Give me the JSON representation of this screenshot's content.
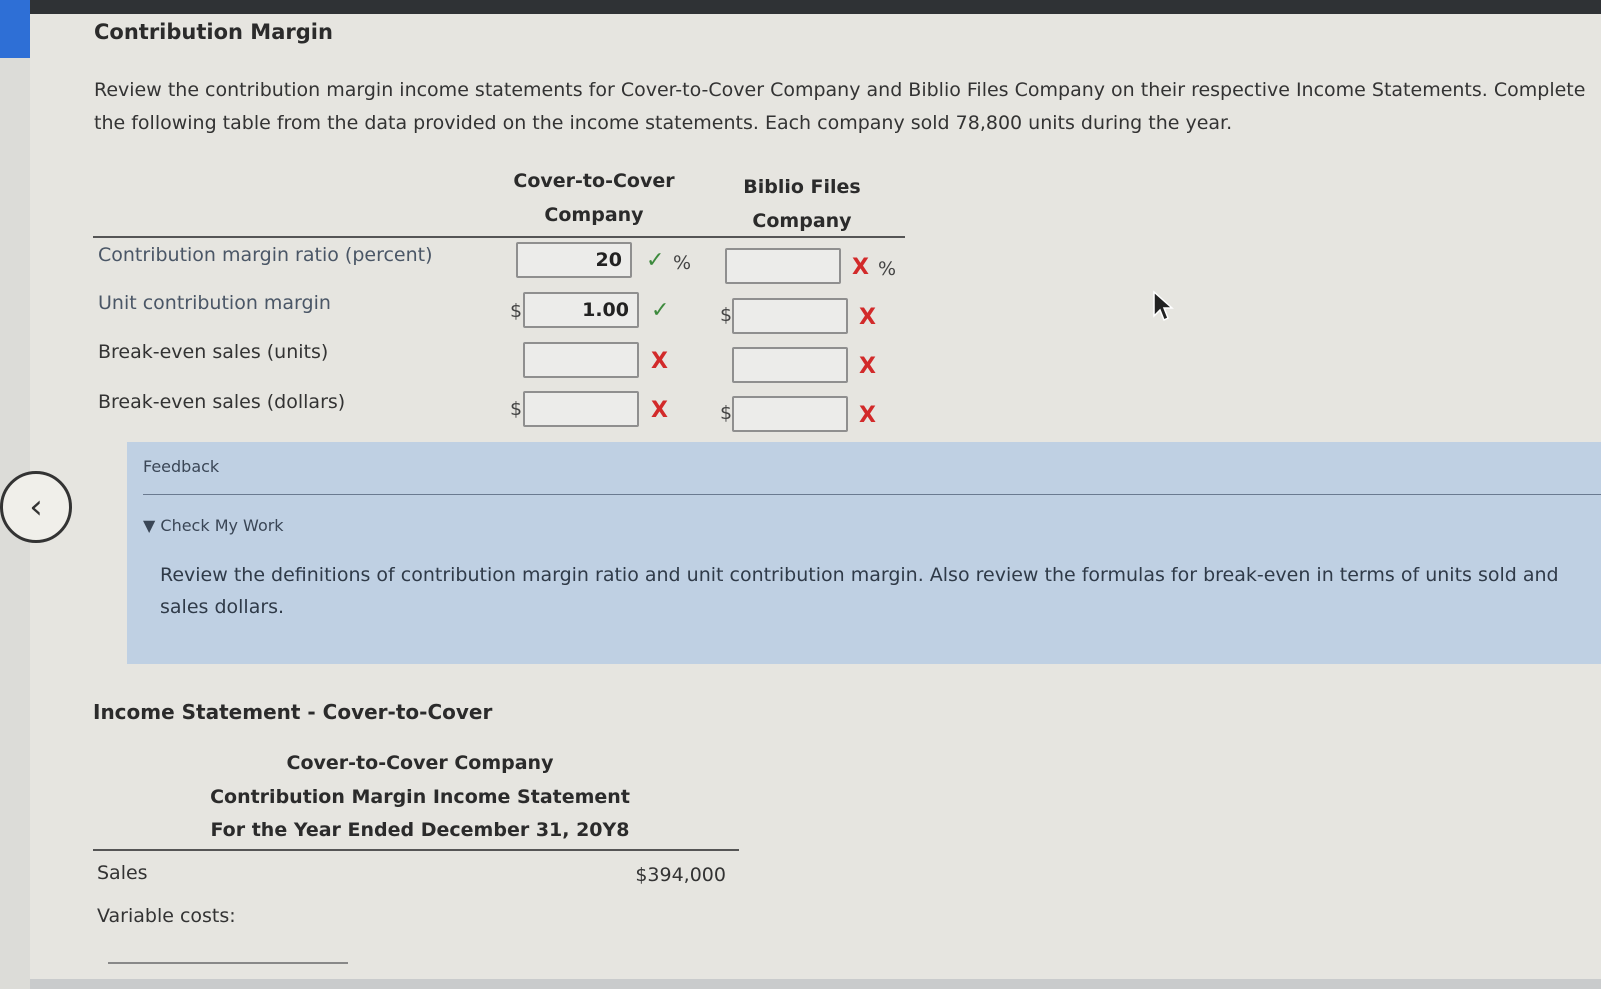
{
  "title": "Contribution Margin",
  "intro": "Review the contribution margin income statements for Cover-to-Cover Company and Biblio Files Company on their respective Income Statements. Complete the following table from the data provided on the income statements. Each company sold 78,800 units during the year.",
  "table": {
    "col1": {
      "line1": "Cover-to-Cover",
      "line2": "Company"
    },
    "col2": {
      "line1": "Biblio Files",
      "line2": "Company"
    },
    "rows": [
      {
        "label": "Contribution margin ratio (percent)",
        "c1_value": "20",
        "c1_status": "correct",
        "c2_value": "",
        "c2_status": "incorrect",
        "unit": "%"
      },
      {
        "label": "Unit contribution margin",
        "currency": "$",
        "c1_value": "1.00",
        "c1_status": "correct",
        "c2_value": "",
        "c2_status": "incorrect"
      },
      {
        "label": "Break-even sales (units)",
        "c1_value": "",
        "c1_status": "incorrect",
        "c2_value": "",
        "c2_status": "incorrect"
      },
      {
        "label": "Break-even sales (dollars)",
        "currency": "$",
        "c1_value": "",
        "c1_status": "incorrect",
        "c2_value": "",
        "c2_status": "incorrect"
      }
    ],
    "marks": {
      "correct": "✓",
      "incorrect": "X"
    }
  },
  "feedback": {
    "title": "Feedback",
    "check_label": "▼ Check My Work",
    "text": "Review the definitions of contribution margin ratio and unit contribution margin. Also review the formulas for break-even in terms of units sold and sales dollars."
  },
  "income_statement": {
    "section_title": "Income Statement - Cover-to-Cover",
    "heading1": "Cover-to-Cover Company",
    "heading2": "Contribution Margin Income Statement",
    "heading3": "For the Year Ended December 31, 20Y8",
    "sales_label": "Sales",
    "sales_value": "$394,000",
    "variable_costs_label": "Variable costs:"
  },
  "icons": {
    "back": "chevron-left-icon"
  },
  "colors": {
    "correct": "#3d8a3d",
    "incorrect": "#d22a2a",
    "feedback_bg": "#bfd0e3"
  }
}
